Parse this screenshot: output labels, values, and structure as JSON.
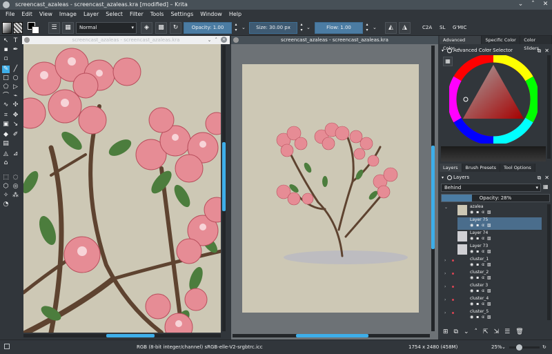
{
  "window": {
    "title": "screencast_azaleas - screencast_azaleas.kra [modified] – Krita",
    "controls": [
      "⌄",
      "˄",
      "✕"
    ]
  },
  "menu": [
    "File",
    "Edit",
    "View",
    "Image",
    "Layer",
    "Select",
    "Filter",
    "Tools",
    "Settings",
    "Window",
    "Help"
  ],
  "toolbar": {
    "blend_mode": "Normal",
    "opacity_label": "Opacity:",
    "opacity_value": "1.00",
    "size_label": "Size:",
    "size_value": "30.00 px",
    "flow_label": "Flow:",
    "flow_value": "1.00",
    "extras": [
      "C2A",
      "SL",
      "G'MIC"
    ]
  },
  "views": [
    {
      "title": "screencast_azaleas - screencast_azaleas.kra"
    },
    {
      "title": "screencast_azaleas - screencast_azaleas.kra"
    }
  ],
  "dock": {
    "top_tabs": [
      "Advanced Color ...",
      "Specific Color ...",
      "Color Sliders"
    ],
    "color_selector_title": "Advanced Color Selector",
    "bottom_tabs": [
      "Layers",
      "Brush Presets",
      "Tool Options"
    ],
    "layers_title": "Layers",
    "blending": "Behind",
    "opacity": "Opacity: 28%",
    "layers": [
      {
        "name": "azalea"
      },
      {
        "name": "Layer 75"
      },
      {
        "name": "Layer 74"
      },
      {
        "name": "Layer 73"
      },
      {
        "name": "cluster_1"
      },
      {
        "name": "cluster_2"
      },
      {
        "name": "cluster 3"
      },
      {
        "name": "cluster_4"
      },
      {
        "name": "cluster_5"
      }
    ]
  },
  "status": {
    "color_space": "RGB (8-bit integer/channel)  sRGB-elle-V2-srgbtrc.icc",
    "dimensions": "1754 x 2480 (458M)",
    "zoom": "25%"
  },
  "colors": {
    "accent": "#3daee9",
    "bg": "#31363b",
    "canvas": "#cdc8b5",
    "selection": "#4a6d8c"
  }
}
